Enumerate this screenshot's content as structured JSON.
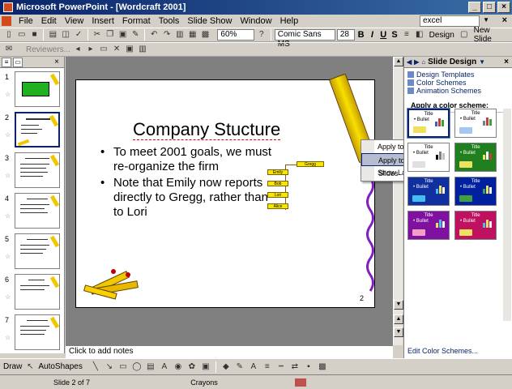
{
  "window": {
    "title": "Microsoft PowerPoint - [Wordcraft 2001]",
    "minimize": "_",
    "maximize": "□",
    "close": "×"
  },
  "menubar": {
    "items": [
      "File",
      "Edit",
      "View",
      "Insert",
      "Format",
      "Tools",
      "Slide Show",
      "Window",
      "Help"
    ],
    "help_query": "excel",
    "close": "×"
  },
  "toolbar": {
    "zoom": "60%",
    "font": "Comic Sans MS",
    "font_size": "28",
    "bold": "B",
    "italic": "I",
    "underline": "U",
    "shadow": "S",
    "design_label": "Design",
    "new_slide_label": "New Slide",
    "reviewers_label": "Reviewers..."
  },
  "slides_pane": {
    "close": "×",
    "thumbnails": [
      {
        "number": "1",
        "selected": false
      },
      {
        "number": "2",
        "selected": true
      },
      {
        "number": "3",
        "selected": false
      },
      {
        "number": "4",
        "selected": false
      },
      {
        "number": "5",
        "selected": false
      },
      {
        "number": "6",
        "selected": false
      },
      {
        "number": "7",
        "selected": false
      }
    ]
  },
  "slide": {
    "title": "Company Stucture",
    "bullets": [
      "To meet 2001 goals, we must re-organize the firm",
      "Note that Emily now reports directly to Gregg, rather than to Lori"
    ],
    "bullet_char": "•",
    "number": "2",
    "org_chart": {
      "top": "Gregg",
      "children": [
        "Emily",
        "Bob",
        "Lori",
        "Alice"
      ]
    }
  },
  "notes": {
    "placeholder": "Click to add notes"
  },
  "context_menu": {
    "items": [
      "Apply to All Slides",
      "Apply to Selected Slides",
      "Show Large Previews"
    ],
    "highlighted_index": 1
  },
  "task_pane": {
    "title": "Slide Design",
    "close": "×",
    "links": [
      "Design Templates",
      "Color Schemes",
      "Animation Schemes"
    ],
    "section": "Apply a color scheme:",
    "scheme_labels": {
      "title": "Title",
      "bullet": "• Bullet"
    },
    "schemes": [
      {
        "bg": "#ffffff",
        "fg": "#000000",
        "shape": "#f0e060",
        "bars": [
          "#4060c0",
          "#c04040",
          "#40a040"
        ],
        "selected": true
      },
      {
        "bg": "#ffffff",
        "fg": "#000000",
        "shape": "#a0c8f0",
        "bars": [
          "#808080",
          "#c04040",
          "#40a040"
        ],
        "selected": false
      },
      {
        "bg": "#ffffff",
        "fg": "#000000",
        "shape": "#e0e0e0",
        "bars": [
          "#000000",
          "#808080",
          "#c0c0c0"
        ],
        "selected": false
      },
      {
        "bg": "#208020",
        "fg": "#ffffff",
        "shape": "#f0e060",
        "bars": [
          "#f0e060",
          "#ffffff",
          "#c04040"
        ],
        "selected": false
      },
      {
        "bg": "#1030a0",
        "fg": "#ffffff",
        "shape": "#40c0f0",
        "bars": [
          "#40c0f0",
          "#f0e060",
          "#ffffff"
        ],
        "selected": false
      },
      {
        "bg": "#0020a0",
        "fg": "#ffffff",
        "shape": "#40a040",
        "bars": [
          "#40a040",
          "#f0e060",
          "#ffffff"
        ],
        "selected": false
      },
      {
        "bg": "#8010a0",
        "fg": "#ffffff",
        "shape": "#f0a0c0",
        "bars": [
          "#f0e060",
          "#40c0f0",
          "#ffffff"
        ],
        "selected": false
      },
      {
        "bg": "#c01060",
        "fg": "#ffffff",
        "shape": "#f0e060",
        "bars": [
          "#40c0f0",
          "#f0e060",
          "#ffffff"
        ],
        "selected": false
      }
    ],
    "edit_link": "Edit Color Schemes..."
  },
  "drawing_toolbar": {
    "draw_label": "Draw",
    "autoshapes_label": "AutoShapes"
  },
  "statusbar": {
    "slide_position": "Slide 2 of 7",
    "design_name": "Crayons"
  }
}
